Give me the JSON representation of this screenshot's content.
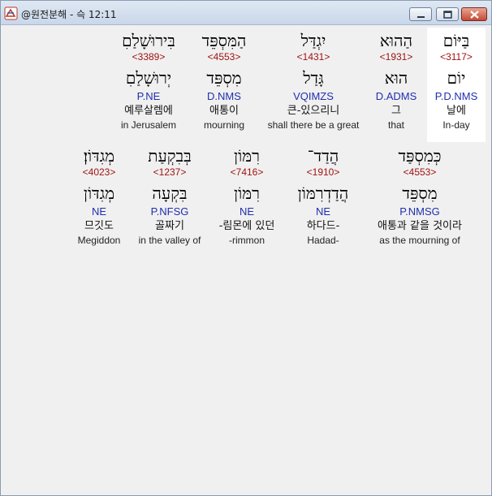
{
  "window": {
    "title": "@원전분해 - 슥 12:11"
  },
  "rows": [
    {
      "words": [
        {
          "heb": "בַּיּוֹם",
          "strong": "<3117>",
          "lemma": "יוֹם",
          "morph": "P.D.NMS",
          "kor": "날에",
          "eng": "In-day"
        },
        {
          "heb": "הַהוּא",
          "strong": "<1931>",
          "lemma": "הוּא",
          "morph": "D.ADMS",
          "kor": "그",
          "eng": "that"
        },
        {
          "heb": "יִגְדַּל",
          "strong": "<1431>",
          "lemma": "גָּדַל",
          "morph": "VQIMZS",
          "kor": "큰-있으리니",
          "eng": "shall there be a great"
        },
        {
          "heb": "הַמִּסְפֵּד",
          "strong": "<4553>",
          "lemma": "מִסְפֵּד",
          "morph": "D.NMS",
          "kor": "애통이",
          "eng": "mourning"
        },
        {
          "heb": "בִּירוּשָׁלַםִ",
          "strong": "<3389>",
          "lemma": "יְרוּשָׁלַםִ",
          "morph": "P.NE",
          "kor": "예루살렘에",
          "eng": "in Jerusalem"
        }
      ]
    },
    {
      "words": [
        {
          "heb": "כְּמִסְפַּד",
          "strong": "<4553>",
          "lemma": "מִסְפֵּד",
          "morph": "P.NMSG",
          "kor": "애통과 같을 것이라",
          "eng": "as the mourning of"
        },
        {
          "heb": "הֲדַד־",
          "strong": "<1910>",
          "lemma": "הֲדַדְרִמּוֹן",
          "morph": "NE",
          "kor": "하다드-",
          "eng": "Hadad-"
        },
        {
          "heb": "רִמּוֹן",
          "strong": "<7416>",
          "lemma": "רִמּוֹן",
          "morph": "NE",
          "kor": "-림몬에 있던",
          "eng": "-rimmon"
        },
        {
          "heb": "בְּבִקְעַת",
          "strong": "<1237>",
          "lemma": "בִּקְעָה",
          "morph": "P.NFSG",
          "kor": "골짜기",
          "eng": "in the valley of"
        },
        {
          "heb": "מְגִדּוֹן׃",
          "strong": "<4023>",
          "lemma": "מְגִדּוֹן",
          "morph": "NE",
          "kor": "므깃도",
          "eng": "Megiddon"
        }
      ]
    }
  ]
}
